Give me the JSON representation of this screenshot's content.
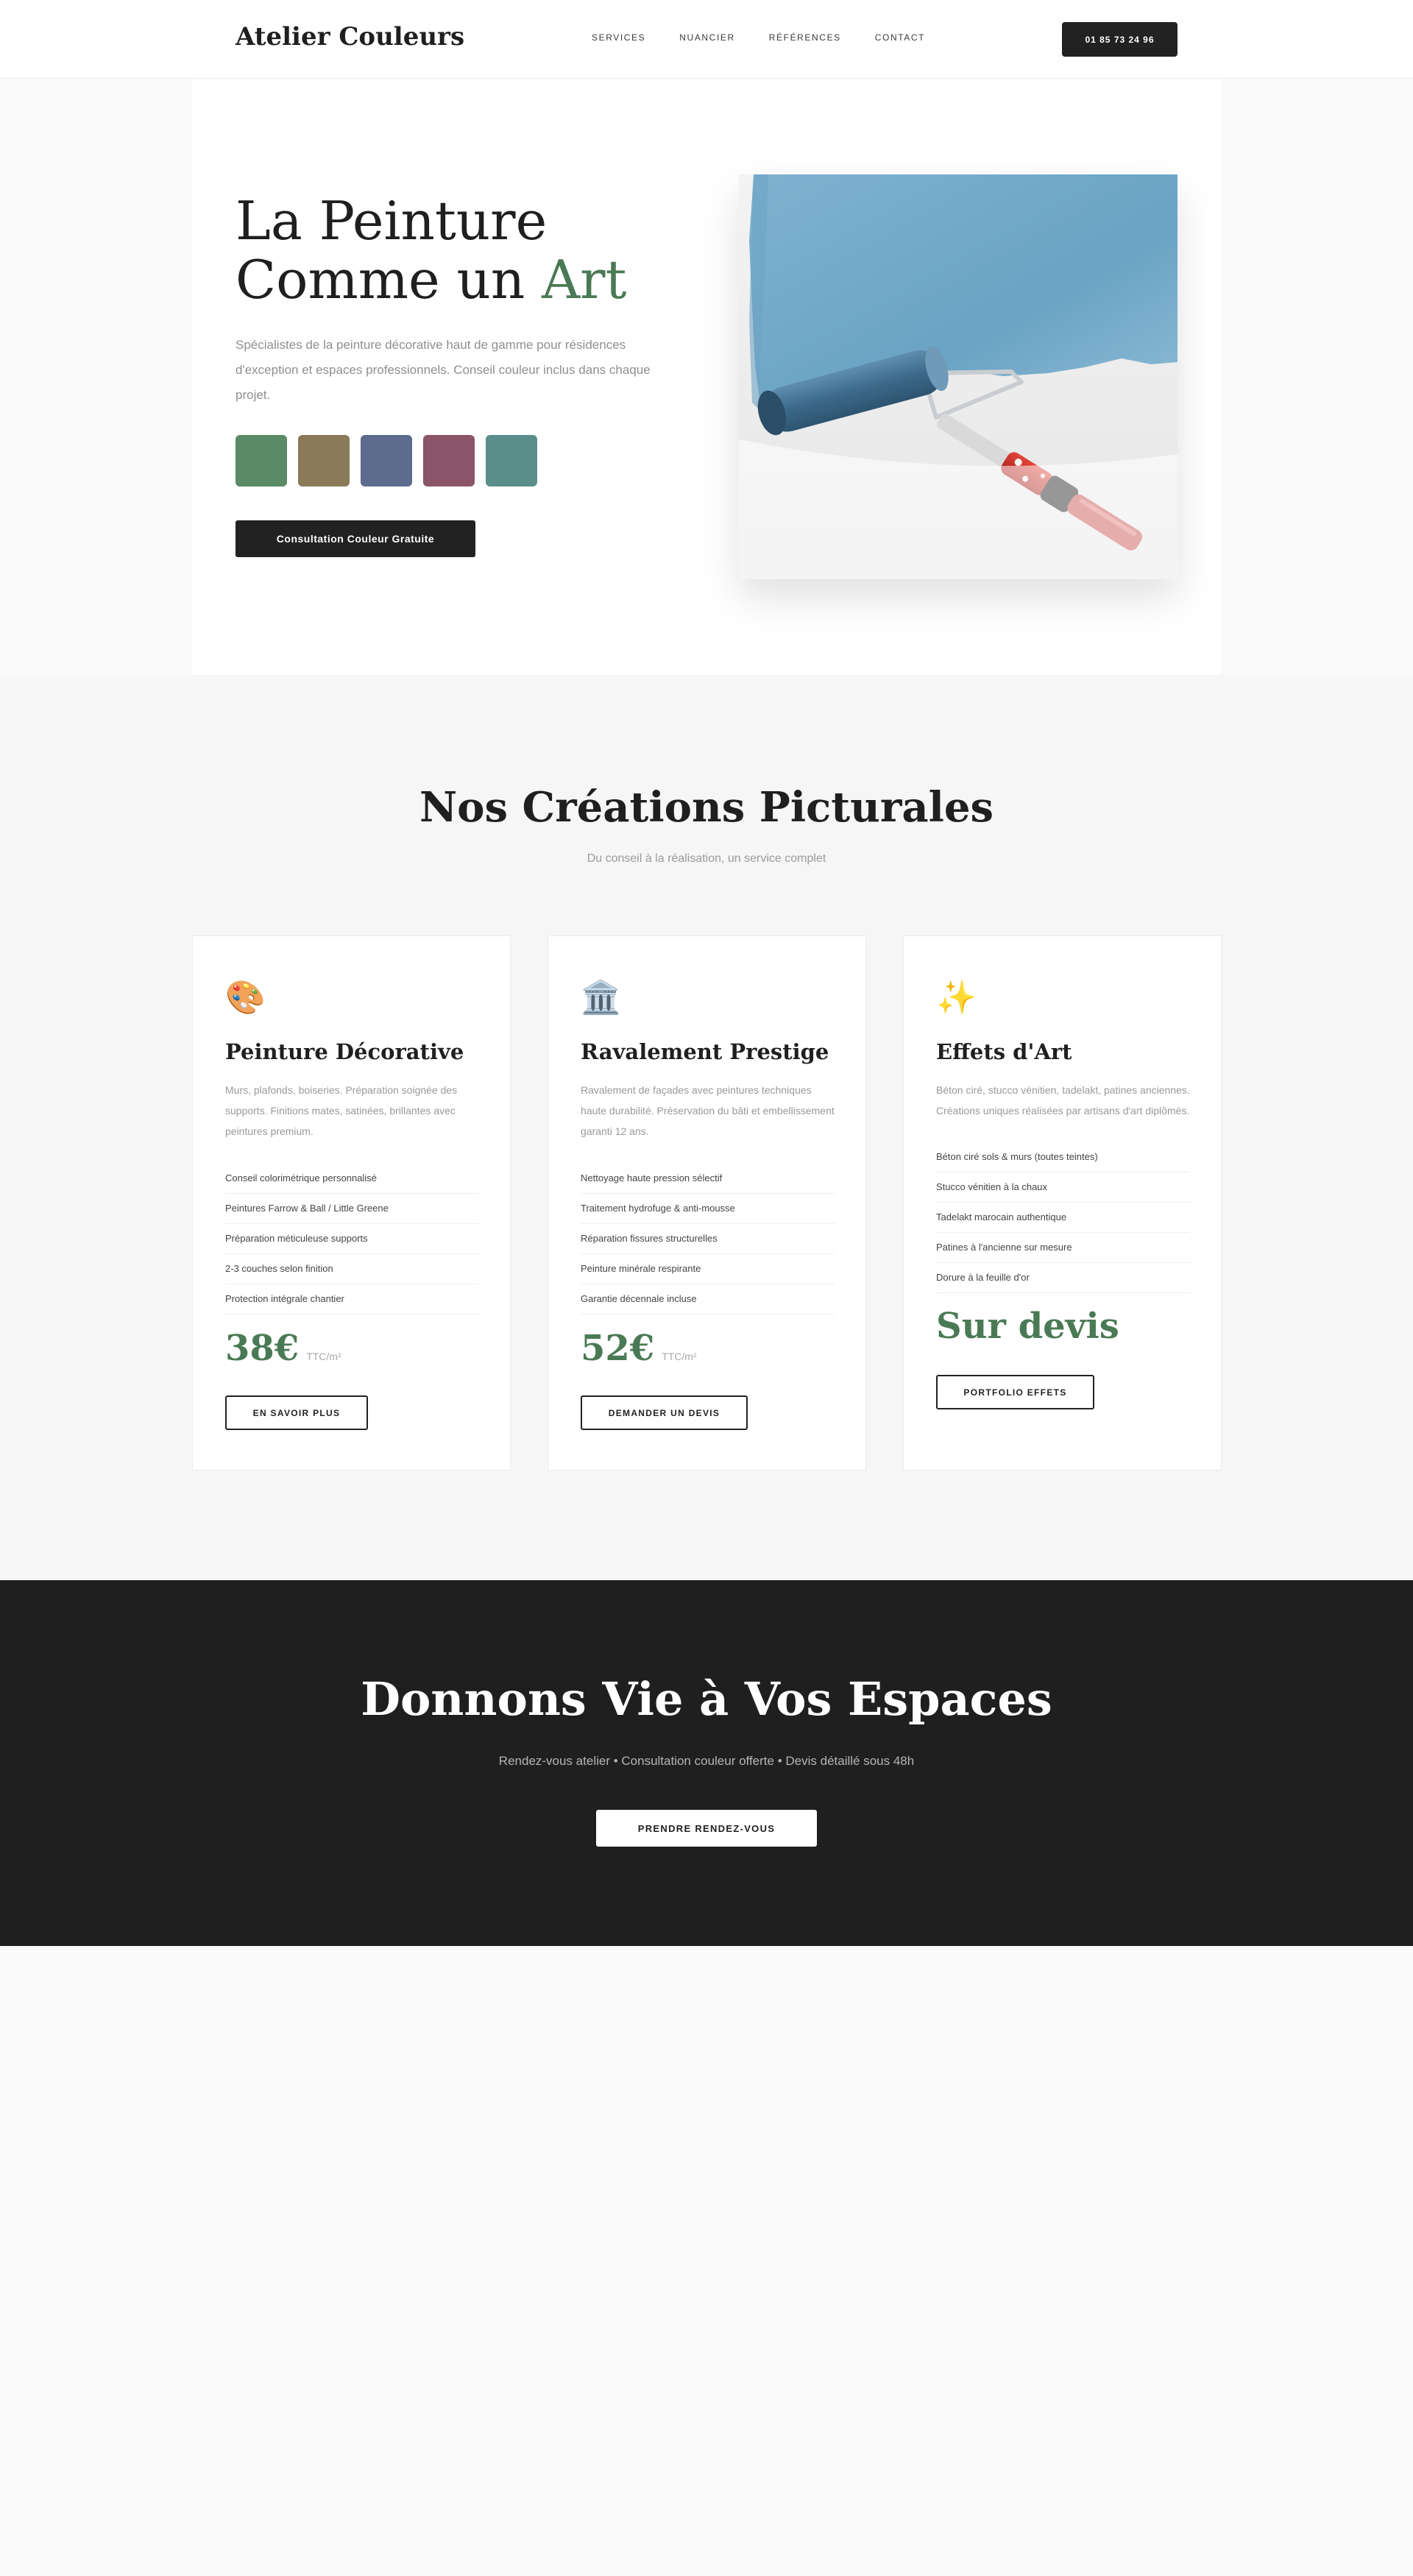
{
  "nav": {
    "brand": "Atelier Couleurs",
    "links": [
      "SERVICES",
      "NUANCIER",
      "RÉFÉRENCES",
      "CONTACT"
    ],
    "phone": "01 85 73 24 96"
  },
  "hero": {
    "title_line1": "La Peinture",
    "title_line2_prefix": "Comme un ",
    "title_accent": "Art",
    "description": "Spécialistes de la peinture décorative haut de gamme pour résidences d'exception et espaces professionnels. Conseil couleur inclus dans chaque projet.",
    "swatches": [
      "#5a8a66",
      "#8a7a58",
      "#5c6b8e",
      "#8a5568",
      "#5a8e8a"
    ],
    "cta": "Consultation Couleur Gratuite",
    "image": "paint-roller-photo"
  },
  "services": {
    "title": "Nos Créations Picturales",
    "subtitle": "Du conseil à la réalisation, un service complet",
    "cards": [
      {
        "icon": "🎨",
        "title": "Peinture Décorative",
        "description": "Murs, plafonds, boiseries. Préparation soignée des supports. Finitions mates, satinées, brillantes avec peintures premium.",
        "features": [
          "Conseil colorimétrique personnalisé",
          "Peintures Farrow & Ball / Little Greene",
          "Préparation méticuleuse supports",
          "2-3 couches selon finition",
          "Protection intégrale chantier"
        ],
        "price": "38€",
        "unit": "TTC/m²",
        "button": "EN SAVOIR PLUS"
      },
      {
        "icon": "🏛️",
        "title": "Ravalement Prestige",
        "description": "Ravalement de façades avec peintures techniques haute durabilité. Préservation du bâti et embellissement garanti 12 ans.",
        "features": [
          "Nettoyage haute pression sélectif",
          "Traitement hydrofuge & anti-mousse",
          "Réparation fissures structurelles",
          "Peinture minérale respirante",
          "Garantie décennale incluse"
        ],
        "price": "52€",
        "unit": "TTC/m²",
        "button": "DEMANDER UN DEVIS"
      },
      {
        "icon": "✨",
        "title": "Effets d'Art",
        "description": "Béton ciré, stucco vénitien, tadelakt, patines anciennes. Créations uniques réalisées par artisans d'art diplômés.",
        "features": [
          "Béton ciré sols & murs (toutes teintes)",
          "Stucco vénitien à la chaux",
          "Tadelakt marocain authentique",
          "Patines à l'ancienne sur mesure",
          "Dorure à la feuille d'or"
        ],
        "price": "Sur devis",
        "unit": "",
        "button": "PORTFOLIO EFFETS"
      }
    ]
  },
  "cta": {
    "title": "Donnons Vie à Vos Espaces",
    "subtitle": "Rendez-vous atelier • Consultation couleur offerte • Devis détaillé sous 48h",
    "button": "PRENDRE RENDEZ-VOUS"
  }
}
